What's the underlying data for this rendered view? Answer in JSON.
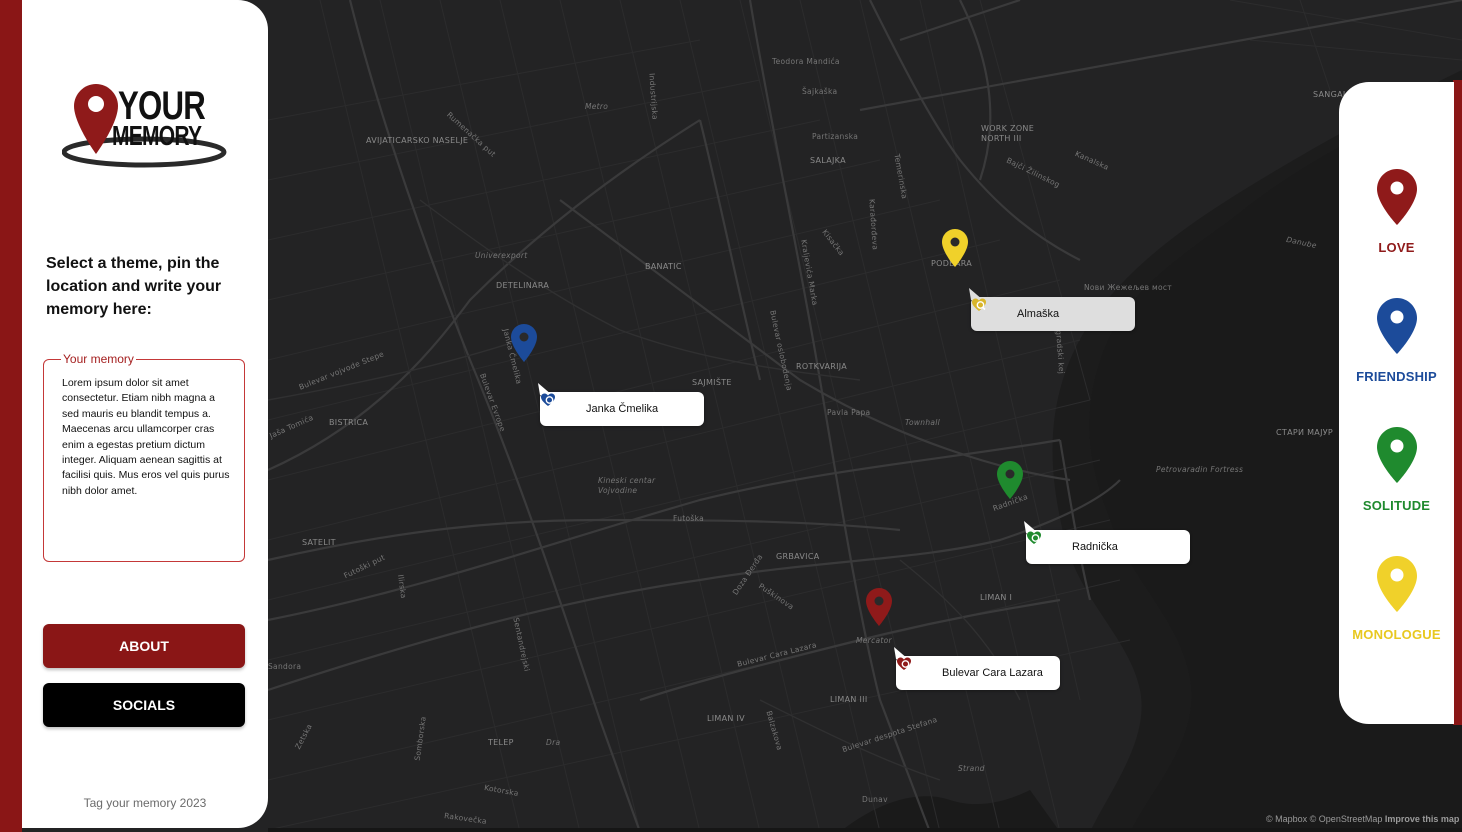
{
  "logo": {
    "line1": "YOUR",
    "line2": "MEMORY"
  },
  "left_panel": {
    "instructions": "Select a theme, pin the location and write your memory here:",
    "memory_label": "Your memory",
    "memory_text": "Lorem ipsum dolor sit amet consectetur. Etiam nibh magna a sed mauris eu blandit tempus a. Maecenas arcu ullamcorper cras enim a egestas pretium dictum integer. Aliquam aenean sagittis at facilisi quis. Mus eros vel quis purus nibh dolor amet.",
    "about_button": "ABOUT",
    "socials_button": "SOCIALS",
    "footer": "Tag your memory 2023"
  },
  "themes": [
    {
      "label": "LOVE",
      "color": "#8f1a1a",
      "icon": "map-pin-icon"
    },
    {
      "label": "FRIENDSHIP",
      "color": "#1c4b9a",
      "icon": "map-pin-icon"
    },
    {
      "label": "SOLITUDE",
      "color": "#1f8a2e",
      "icon": "map-pin-icon"
    },
    {
      "label": "MONOLOGUE",
      "color": "#f0d12a",
      "icon": "map-pin-icon"
    }
  ],
  "memories": [
    {
      "label": "Almaška",
      "theme": "MONOLOGUE",
      "color": "#f0d12a"
    },
    {
      "label": "Janka Čmelika",
      "theme": "FRIENDSHIP",
      "color": "#1c4b9a"
    },
    {
      "label": "Radnička",
      "theme": "SOLITUDE",
      "color": "#1f8a2e"
    },
    {
      "label": "Bulevar Cara Lazara",
      "theme": "LOVE",
      "color": "#8f1a1a"
    }
  ],
  "map_labels": {
    "districts": [
      "AVIJATICARSKO NASELJE",
      "BANATIC",
      "DETELINARA",
      "SAJMIŠTE",
      "ROTKVARIJA",
      "SALAJKA",
      "PODBARA",
      "WORK ZONE NORTH III",
      "BISTRICA",
      "SATELIT",
      "GRBAVICA",
      "LIMAN I",
      "LIMAN III",
      "LIMAN IV",
      "TELEP",
      "SANGAJ",
      "СТАРИ МАЈУР"
    ],
    "streets": [
      "Teodora Mandića",
      "Šajkaška",
      "Partizanska",
      "Rumenačka put",
      "Metro",
      "Industrijska",
      "Temerinska",
      "Kanalska",
      "Bajči Žilinskog",
      "Nови Жежељев мост",
      "Danube",
      "Kisačka",
      "Karađorđeva",
      "Kraljevića Marka",
      "Bulevar oslobođenja",
      "Univerexport",
      "Bulevar vojvode Stepe",
      "Janka Čmelika",
      "Bulevar Evrope",
      "Pavla Papa",
      "Townhall",
      "Futoška",
      "Kineski centar Vojvodine",
      "Beogradski kej",
      "Petrovaradin Fortress",
      "Bulevar Cara Lazara",
      "Mercator",
      "Bulevar despota Stefana",
      "Futoški put",
      "Sentandrejski",
      "Strand",
      "Dunav",
      "Dra",
      "Kotorska",
      "Rakovečka",
      "Sandora",
      "Ilirska",
      "Somborska",
      "Puškinova",
      "Doza Đerđa",
      "Balzakova",
      "Zetska",
      "Jaša Tomića",
      "Radnička",
      "Podbara",
      "Almaška"
    ]
  },
  "attribution": {
    "mapbox": "© Mapbox",
    "osm": "© OpenStreetMap",
    "improve": "Improve this map"
  }
}
